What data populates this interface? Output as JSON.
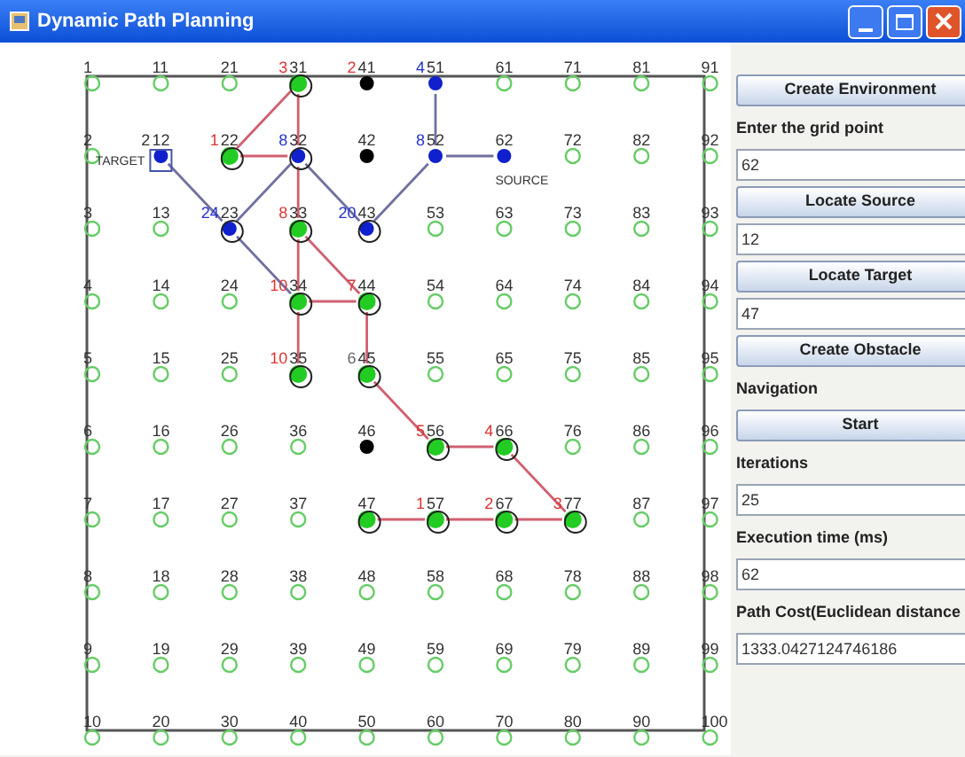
{
  "window": {
    "title": "Dynamic Path Planning"
  },
  "grid": {
    "nodes": [
      {
        "label": "1",
        "kind": "open"
      },
      {
        "label": "2",
        "kind": "open"
      },
      {
        "label": "3",
        "kind": "open"
      },
      {
        "label": "4",
        "kind": "open"
      },
      {
        "label": "5",
        "kind": "open"
      },
      {
        "label": "6",
        "kind": "open"
      },
      {
        "label": "7",
        "kind": "open"
      },
      {
        "label": "8",
        "kind": "open"
      },
      {
        "label": "9",
        "kind": "open"
      },
      {
        "label": "10",
        "kind": "open"
      },
      {
        "label": "11",
        "kind": "open"
      },
      {
        "label": "12",
        "kind": "frontier",
        "order": "2",
        "color": "#333333",
        "tag": "TARGET",
        "links": [
          {
            "kind": "down-right",
            "color": "#7070a0"
          }
        ]
      },
      {
        "label": "13",
        "kind": "open"
      },
      {
        "label": "14",
        "kind": "open"
      },
      {
        "label": "15",
        "kind": "open"
      },
      {
        "label": "16",
        "kind": "open"
      },
      {
        "label": "17",
        "kind": "open"
      },
      {
        "label": "18",
        "kind": "open"
      },
      {
        "label": "19",
        "kind": "open"
      },
      {
        "label": "20",
        "kind": "open"
      },
      {
        "label": "21",
        "kind": "open"
      },
      {
        "label": "22",
        "kind": "visited",
        "order": "1",
        "color": "#dd3333",
        "links": [
          {
            "kind": "right",
            "color": "#d06070"
          }
        ]
      },
      {
        "label": "23",
        "kind": "frontier_ring",
        "order": "24",
        "color": "#2233cc",
        "links": [
          {
            "kind": "down-right",
            "color": "#7070a0"
          }
        ]
      },
      {
        "label": "24",
        "kind": "open"
      },
      {
        "label": "25",
        "kind": "open"
      },
      {
        "label": "26",
        "kind": "open"
      },
      {
        "label": "27",
        "kind": "open"
      },
      {
        "label": "28",
        "kind": "open"
      },
      {
        "label": "29",
        "kind": "open"
      },
      {
        "label": "30",
        "kind": "open"
      },
      {
        "label": "31",
        "kind": "visited",
        "order": "3",
        "color": "#dd3333",
        "links": [
          {
            "kind": "down-left",
            "color": "#d06070"
          },
          {
            "kind": "down",
            "color": "#d06070"
          }
        ]
      },
      {
        "label": "32",
        "kind": "frontier_ring",
        "order": "8",
        "color": "#2233cc",
        "links": [
          {
            "kind": "down",
            "color": "#d06070"
          },
          {
            "kind": "down-left",
            "color": "#7070a0"
          },
          {
            "kind": "down-right",
            "color": "#7070a0"
          }
        ]
      },
      {
        "label": "33",
        "kind": "visited",
        "order": "8",
        "color": "#dd3333",
        "links": [
          {
            "kind": "down",
            "color": "#d06070"
          },
          {
            "kind": "down-right",
            "color": "#d06070"
          }
        ]
      },
      {
        "label": "34",
        "kind": "visited",
        "order": "10",
        "color": "#dd3333",
        "links": [
          {
            "kind": "right",
            "color": "#d06070"
          },
          {
            "kind": "down",
            "color": "#d06070"
          }
        ]
      },
      {
        "label": "35",
        "kind": "visited",
        "order": "10",
        "color": "#dd3333"
      },
      {
        "label": "36",
        "kind": "open"
      },
      {
        "label": "37",
        "kind": "open"
      },
      {
        "label": "38",
        "kind": "open"
      },
      {
        "label": "39",
        "kind": "open"
      },
      {
        "label": "40",
        "kind": "open"
      },
      {
        "label": "41",
        "kind": "obstacle",
        "order": "2",
        "color": "#dd3333"
      },
      {
        "label": "42",
        "kind": "obstacle"
      },
      {
        "label": "43",
        "kind": "frontier_ring",
        "order": "20",
        "color": "#2233cc"
      },
      {
        "label": "44",
        "kind": "visited",
        "order": "7",
        "color": "#dd3333",
        "links": [
          {
            "kind": "down",
            "color": "#d06070"
          }
        ]
      },
      {
        "label": "45",
        "kind": "visited",
        "order": "6",
        "color": "#666666",
        "links": [
          {
            "kind": "down-right",
            "color": "#d06070"
          }
        ]
      },
      {
        "label": "46",
        "kind": "obstacle"
      },
      {
        "label": "47",
        "kind": "visited",
        "links": [
          {
            "kind": "right",
            "color": "#d06070"
          }
        ]
      },
      {
        "label": "48",
        "kind": "open"
      },
      {
        "label": "49",
        "kind": "open"
      },
      {
        "label": "50",
        "kind": "open"
      },
      {
        "label": "51",
        "kind": "frontier",
        "order": "4",
        "color": "#2233cc",
        "links": [
          {
            "kind": "down",
            "color": "#7070a0"
          }
        ]
      },
      {
        "label": "52",
        "kind": "frontier",
        "order": "8",
        "color": "#2233cc",
        "links": [
          {
            "kind": "right",
            "color": "#7070a0"
          },
          {
            "kind": "down-left",
            "color": "#7070a0"
          }
        ]
      },
      {
        "label": "53",
        "kind": "open"
      },
      {
        "label": "54",
        "kind": "open"
      },
      {
        "label": "55",
        "kind": "open"
      },
      {
        "label": "56",
        "kind": "visited",
        "order": "5",
        "color": "#dd3333",
        "links": [
          {
            "kind": "right",
            "color": "#d06070"
          }
        ]
      },
      {
        "label": "57",
        "kind": "visited",
        "order": "1",
        "color": "#dd3333",
        "links": [
          {
            "kind": "right",
            "color": "#d06070"
          }
        ]
      },
      {
        "label": "58",
        "kind": "open"
      },
      {
        "label": "59",
        "kind": "open"
      },
      {
        "label": "60",
        "kind": "open"
      },
      {
        "label": "61",
        "kind": "open"
      },
      {
        "label": "62",
        "kind": "frontier",
        "tag": "SOURCE"
      },
      {
        "label": "63",
        "kind": "open"
      },
      {
        "label": "64",
        "kind": "open"
      },
      {
        "label": "65",
        "kind": "open"
      },
      {
        "label": "66",
        "kind": "visited",
        "order": "4",
        "color": "#dd3333",
        "links": [
          {
            "kind": "down-right",
            "color": "#d06070"
          }
        ]
      },
      {
        "label": "67",
        "kind": "visited",
        "order": "2",
        "color": "#dd3333",
        "links": [
          {
            "kind": "right",
            "color": "#d06070"
          }
        ]
      },
      {
        "label": "68",
        "kind": "open"
      },
      {
        "label": "69",
        "kind": "open"
      },
      {
        "label": "70",
        "kind": "open"
      },
      {
        "label": "71",
        "kind": "open"
      },
      {
        "label": "72",
        "kind": "open"
      },
      {
        "label": "73",
        "kind": "open"
      },
      {
        "label": "74",
        "kind": "open"
      },
      {
        "label": "75",
        "kind": "open"
      },
      {
        "label": "76",
        "kind": "open"
      },
      {
        "label": "77",
        "kind": "visited",
        "order": "3",
        "color": "#dd3333"
      },
      {
        "label": "78",
        "kind": "open"
      },
      {
        "label": "79",
        "kind": "open"
      },
      {
        "label": "80",
        "kind": "open"
      },
      {
        "label": "81",
        "kind": "open"
      },
      {
        "label": "82",
        "kind": "open"
      },
      {
        "label": "83",
        "kind": "open"
      },
      {
        "label": "84",
        "kind": "open"
      },
      {
        "label": "85",
        "kind": "open"
      },
      {
        "label": "86",
        "kind": "open"
      },
      {
        "label": "87",
        "kind": "open"
      },
      {
        "label": "88",
        "kind": "open"
      },
      {
        "label": "89",
        "kind": "open"
      },
      {
        "label": "90",
        "kind": "open"
      },
      {
        "label": "91",
        "kind": "open"
      },
      {
        "label": "92",
        "kind": "open"
      },
      {
        "label": "93",
        "kind": "open"
      },
      {
        "label": "94",
        "kind": "open"
      },
      {
        "label": "95",
        "kind": "open"
      },
      {
        "label": "96",
        "kind": "open"
      },
      {
        "label": "97",
        "kind": "open"
      },
      {
        "label": "98",
        "kind": "open"
      },
      {
        "label": "99",
        "kind": "open"
      },
      {
        "label": "100",
        "kind": "open"
      }
    ]
  },
  "panel": [
    {
      "kind": "button",
      "text": "Create Environment"
    },
    {
      "kind": "label",
      "text": "Enter the grid point"
    },
    {
      "kind": "field",
      "value": "62"
    },
    {
      "kind": "button",
      "text": "Locate Source"
    },
    {
      "kind": "field",
      "value": "12"
    },
    {
      "kind": "button",
      "text": "Locate Target"
    },
    {
      "kind": "field",
      "value": "47"
    },
    {
      "kind": "button",
      "text": "Create Obstacle"
    },
    {
      "kind": "label",
      "text": "Navigation"
    },
    {
      "kind": "button",
      "text": "Start"
    },
    {
      "kind": "label",
      "text": "Iterations"
    },
    {
      "kind": "field",
      "value": "25"
    },
    {
      "kind": "label",
      "text": "Execution time (ms)"
    },
    {
      "kind": "field",
      "value": "62"
    },
    {
      "kind": "label",
      "text": "Path Cost(Euclidean distance"
    },
    {
      "kind": "field",
      "value": "1333.0427124746186"
    }
  ]
}
